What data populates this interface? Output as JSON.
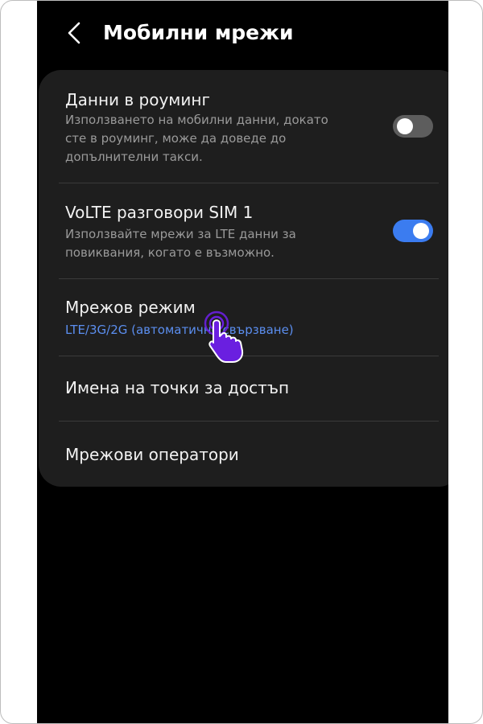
{
  "header": {
    "title": "Мобилни мрежи",
    "back_icon": "chevron-left-icon"
  },
  "settings": {
    "roaming": {
      "title": "Данни в роуминг",
      "desc_lines": [
        "Използването на мобилни данни, докато",
        "сте в роуминг, може да доведе до",
        "допълнителни такси."
      ],
      "enabled": false
    },
    "volte": {
      "title": "VoLTE разговори SIM 1",
      "desc_lines": [
        "Използвайте мрежи за LTE данни за",
        "повиквания, когато е възможно."
      ],
      "enabled": true
    },
    "network_mode": {
      "title": "Мрежов режим",
      "value": "LTE/3G/2G (автоматично свързване)"
    },
    "apn": {
      "title": "Имена на точки за достъп"
    },
    "operators": {
      "title": "Мрежови оператори"
    }
  },
  "colors": {
    "accent": "#3b7cf0",
    "link": "#5b8eef",
    "pointer": "#6a1fe0"
  },
  "pointer_icon": "tap-hand-icon"
}
